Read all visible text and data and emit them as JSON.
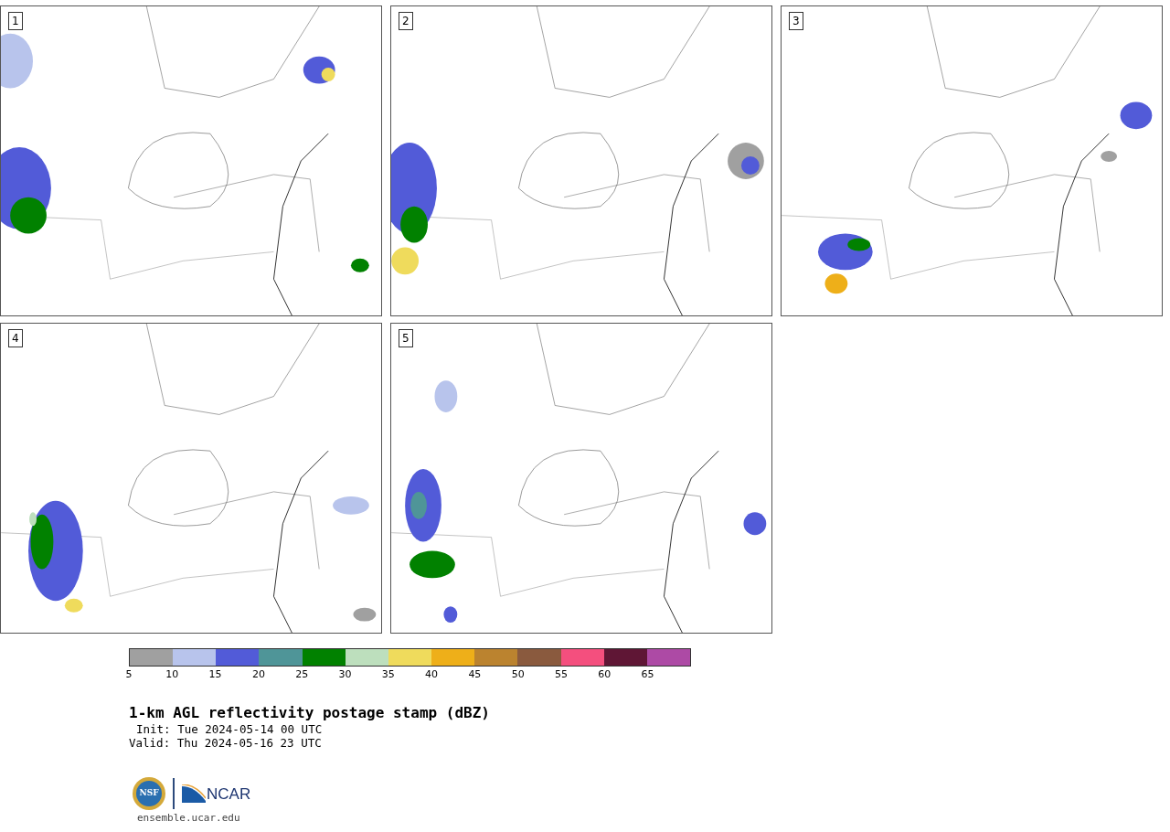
{
  "panels": [
    {
      "label": "1"
    },
    {
      "label": "2"
    },
    {
      "label": "3"
    },
    {
      "label": "4"
    },
    {
      "label": "5"
    }
  ],
  "colorbar": {
    "bins": [
      {
        "color": "#a0a0a0"
      },
      {
        "color": "#b8c4ec"
      },
      {
        "color": "#525bd8"
      },
      {
        "color": "#4f9598"
      },
      {
        "color": "#018100"
      },
      {
        "color": "#bddfbd"
      },
      {
        "color": "#efdb5c"
      },
      {
        "color": "#eeaf19"
      },
      {
        "color": "#bb832f"
      },
      {
        "color": "#8a5a3e"
      },
      {
        "color": "#f44f7e"
      },
      {
        "color": "#5f1635"
      },
      {
        "color": "#ad4aa5"
      }
    ],
    "ticks": [
      "5",
      "10",
      "15",
      "20",
      "25",
      "30",
      "35",
      "40",
      "45",
      "50",
      "55",
      "60",
      "65"
    ]
  },
  "title": "1-km AGL reflectivity postage stamp (dBZ)",
  "init": "Init: Tue 2024-05-14 00 UTC",
  "valid": "Valid: Thu 2024-05-16 23 UTC",
  "logos": {
    "nsf": "NSF",
    "ncar": "NCAR"
  },
  "url": "ensemble.ucar.edu"
}
